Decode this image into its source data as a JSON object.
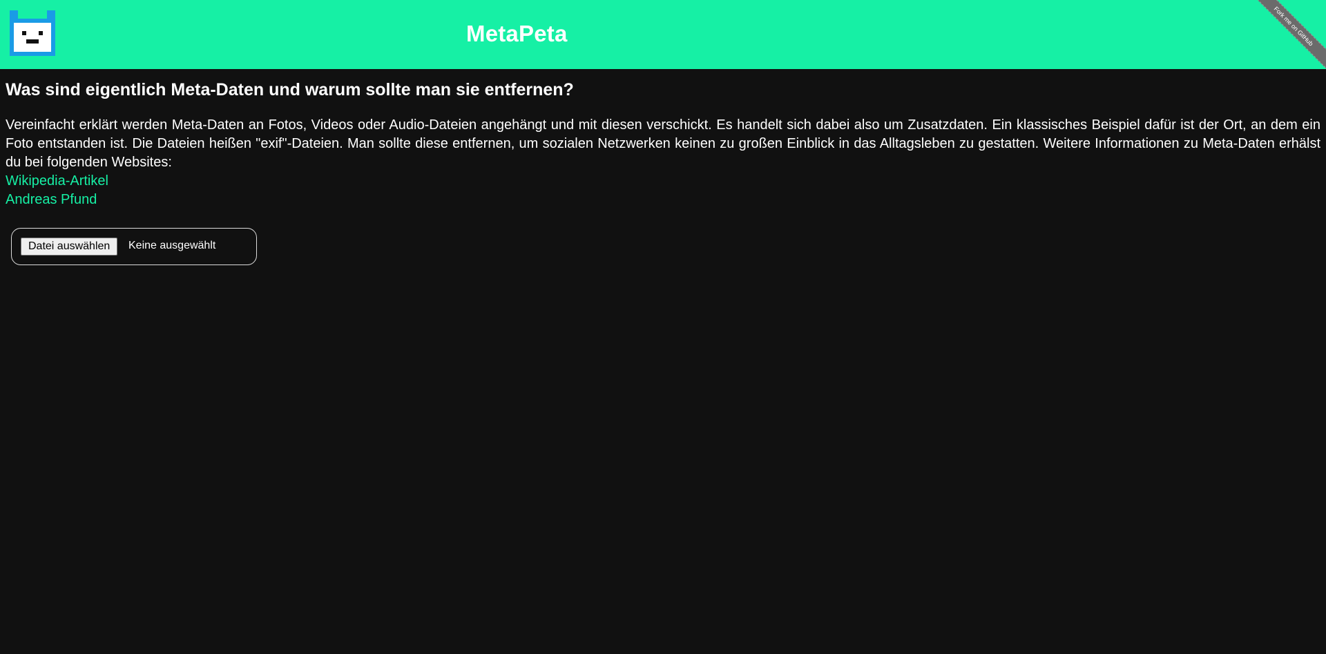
{
  "header": {
    "title": "MetaPeta",
    "logo_icon": "pixel-cat-logo-icon",
    "ribbon_label": "Fork me on GitHub"
  },
  "main": {
    "heading": "Was sind eigentlich Meta-Daten und warum sollte man sie entfernen?",
    "intro": "Vereinfacht erklärt werden Meta-Daten an Fotos, Videos oder Audio-Dateien angehängt und mit diesen verschickt. Es handelt sich dabei also um Zusatzdaten. Ein klassisches Beispiel dafür ist der Ort, an dem ein Foto entstanden ist. Die Dateien heißen \"exif\"-Dateien. Man sollte diese entfernen, um sozialen Netzwerken keinen zu großen Einblick in das Alltagsleben zu gestatten. Weitere Informationen zu Meta-Daten erhälst du bei folgenden Websites:",
    "links": [
      {
        "label": "Wikipedia-Artikel"
      },
      {
        "label": "Andreas Pfund"
      }
    ]
  },
  "upload": {
    "button_label": "Datei auswählen",
    "status": "Keine ausgewählt"
  },
  "colors": {
    "accent": "#16f0a5",
    "background": "#111111",
    "logo_blue": "#1a9be6"
  }
}
